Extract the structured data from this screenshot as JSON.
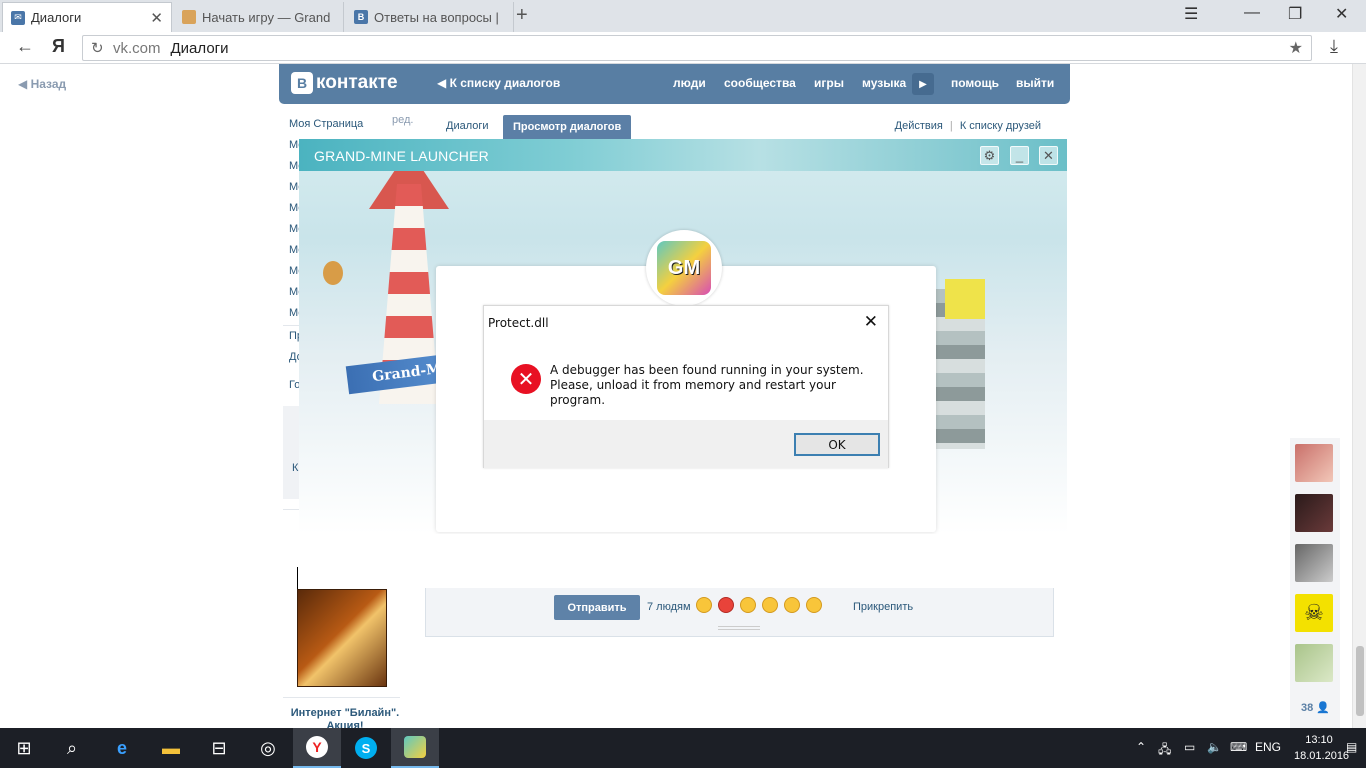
{
  "browser": {
    "tabs": [
      {
        "label": "Диалоги",
        "active": true
      },
      {
        "label": "Начать игру — Grand",
        "active": false
      },
      {
        "label": "Ответы на вопросы |",
        "active": false
      }
    ],
    "url_domain": "vk.com",
    "url_path": "Диалоги",
    "new_tab": "+"
  },
  "vk": {
    "back": "Назад",
    "logo_text": "контакте",
    "logo_letter": "В",
    "to_dialogs": "К списку диалогов",
    "nav": [
      "люди",
      "сообщества",
      "игры",
      "музыка",
      "помощь",
      "выйти"
    ],
    "left_menu": {
      "my_page": "Моя Страница",
      "edit": "ред.",
      "truncated": [
        "Мо",
        "Мо",
        "Мо",
        "Мо",
        "Мо",
        "Мо",
        "Мо",
        "Мо",
        "Мо"
      ],
      "lower": [
        "Пр",
        "До",
        "Го"
      ],
      "ad_letter": "К",
      "ad_title": "Интернет \"Билайн\". Акция!"
    },
    "dialog_tabs": {
      "dialogs": "Диалоги",
      "view": "Просмотр диалогов",
      "actions": "Действия",
      "separator": "|",
      "friends": "К списку друзей"
    },
    "composer": {
      "send": "Отправить",
      "people": "7 людям",
      "attach": "Прикрепить"
    },
    "friends_count": "38"
  },
  "launcher": {
    "title": "GRAND-MINE LAUNCHER",
    "logo": "GM",
    "banner": "Grand-M"
  },
  "dialog": {
    "title": "Protect.dll",
    "line1": "A debugger has been found running in your system.",
    "line2": "Please, unload it from memory and restart your program.",
    "ok": "OK"
  },
  "taskbar": {
    "lang": "ENG",
    "time": "13:10",
    "date": "18.01.2016"
  },
  "colors": {
    "vk_blue": "#587ea3",
    "error_red": "#e81123",
    "taskbar": "#1c1f26"
  }
}
